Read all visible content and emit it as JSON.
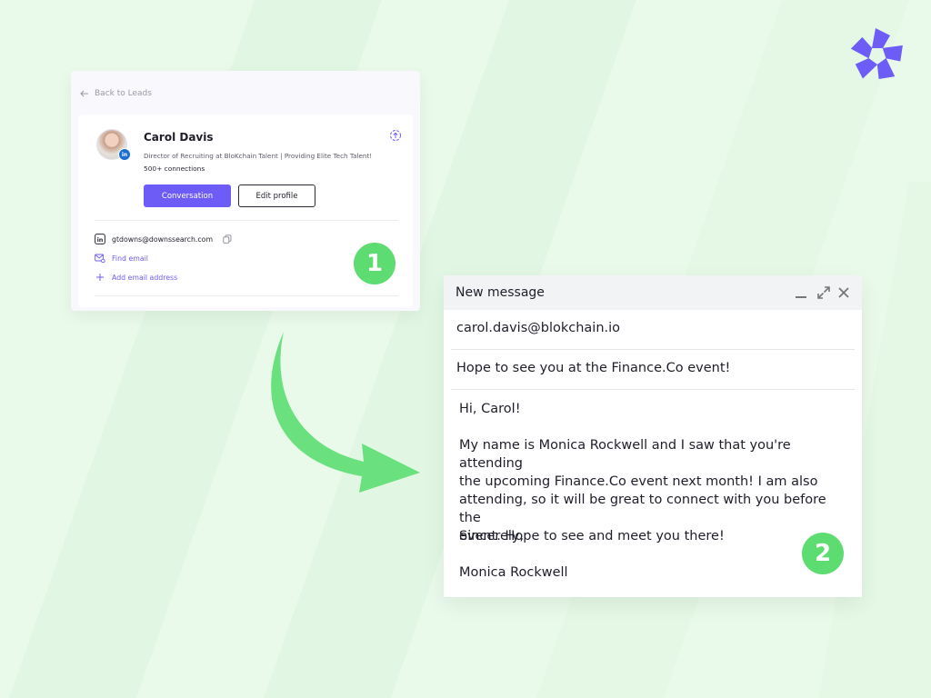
{
  "colors": {
    "background": "#eafaea",
    "accent": "#6d5cf6",
    "step_badge": "#5ddc72",
    "arrow": "#6be07e"
  },
  "brand": {
    "logo_icon": "pinwheel-logo-icon"
  },
  "profile_card": {
    "back_label": "Back to Leads",
    "name": "Carol Davis",
    "headline": "Director of Recruiting at BloKchain Talent | Providing Elite Tech Talent!",
    "connections": "500+ connections",
    "conversation_button": "Conversation",
    "edit_profile_button": "Edit profile",
    "linkedin_email": "gtdowns@downssearch.com",
    "find_email_label": "Find email",
    "add_email_label": "Add email address",
    "step": "1"
  },
  "message": {
    "window_title": "New message",
    "to": "carol.davis@blokchain.io",
    "subject": "Hope to see you at the Finance.Co event!",
    "greeting": "Hi, Carol!",
    "paragraph_lines": [
      "My name is Monica Rockwell and I saw that you're attending",
      "the upcoming Finance.Co event next month! I am also",
      "attending, so it will be great to connect with you before the",
      "event. Hope to see and meet you there!"
    ],
    "closing": "Sincerely,",
    "signature": "Monica Rockwell",
    "step": "2"
  }
}
